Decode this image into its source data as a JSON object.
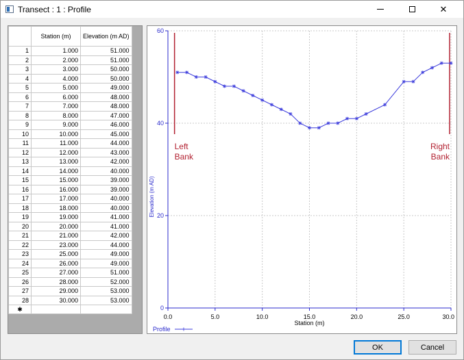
{
  "window": {
    "title": "Transect : 1 : Profile",
    "min_icon": "minimize-icon",
    "max_icon": "maximize-icon",
    "close_glyph": "✕"
  },
  "table": {
    "headers": [
      "Station (m)",
      "Elevation (m AD)"
    ],
    "rows": [
      [
        "1",
        "1.000",
        "51.000"
      ],
      [
        "2",
        "2.000",
        "51.000"
      ],
      [
        "3",
        "3.000",
        "50.000"
      ],
      [
        "4",
        "4.000",
        "50.000"
      ],
      [
        "5",
        "5.000",
        "49.000"
      ],
      [
        "6",
        "6.000",
        "48.000"
      ],
      [
        "7",
        "7.000",
        "48.000"
      ],
      [
        "8",
        "8.000",
        "47.000"
      ],
      [
        "9",
        "9.000",
        "46.000"
      ],
      [
        "10",
        "10.000",
        "45.000"
      ],
      [
        "11",
        "11.000",
        "44.000"
      ],
      [
        "12",
        "12.000",
        "43.000"
      ],
      [
        "13",
        "13.000",
        "42.000"
      ],
      [
        "14",
        "14.000",
        "40.000"
      ],
      [
        "15",
        "15.000",
        "39.000"
      ],
      [
        "16",
        "16.000",
        "39.000"
      ],
      [
        "17",
        "17.000",
        "40.000"
      ],
      [
        "18",
        "18.000",
        "40.000"
      ],
      [
        "19",
        "19.000",
        "41.000"
      ],
      [
        "20",
        "20.000",
        "41.000"
      ],
      [
        "21",
        "21.000",
        "42.000"
      ],
      [
        "22",
        "23.000",
        "44.000"
      ],
      [
        "23",
        "25.000",
        "49.000"
      ],
      [
        "24",
        "26.000",
        "49.000"
      ],
      [
        "25",
        "27.000",
        "51.000"
      ],
      [
        "26",
        "28.000",
        "52.000"
      ],
      [
        "27",
        "29.000",
        "53.000"
      ],
      [
        "28",
        "30.000",
        "53.000"
      ]
    ],
    "new_row_marker": "✱"
  },
  "chart_data": {
    "type": "line",
    "x": [
      1,
      2,
      3,
      4,
      5,
      6,
      7,
      8,
      9,
      10,
      11,
      12,
      13,
      14,
      15,
      16,
      17,
      18,
      19,
      20,
      21,
      23,
      25,
      26,
      27,
      28,
      29,
      30
    ],
    "series": [
      {
        "name": "Profile",
        "color": "#3c3cdc",
        "values": [
          51,
          51,
          50,
          50,
          49,
          48,
          48,
          47,
          46,
          45,
          44,
          43,
          42,
          40,
          39,
          39,
          40,
          40,
          41,
          41,
          42,
          44,
          49,
          49,
          51,
          52,
          53,
          53
        ]
      }
    ],
    "xlabel": "Station (m)",
    "ylabel": "Elevation (m AD)",
    "xlim": [
      0,
      30
    ],
    "ylim": [
      0,
      60
    ],
    "xticks": [
      0,
      5,
      10,
      15,
      20,
      25,
      30
    ],
    "xtick_labels": [
      "0.0",
      "5.0",
      "10.0",
      "15.0",
      "20.0",
      "25.0",
      "30.0"
    ],
    "yticks": [
      0,
      20,
      40,
      60
    ],
    "ytick_labels": [
      "0",
      "20",
      "40",
      "60"
    ],
    "grid": true,
    "legend": "bottom-left",
    "bank_color": "#b22030",
    "banks": [
      {
        "x": 0.7,
        "label_lines": [
          "Left",
          "Bank"
        ],
        "align": "left"
      },
      {
        "x": 30,
        "label_lines": [
          "Right",
          "Bank"
        ],
        "align": "right"
      }
    ]
  },
  "buttons": {
    "ok": "OK",
    "cancel": "Cancel"
  }
}
